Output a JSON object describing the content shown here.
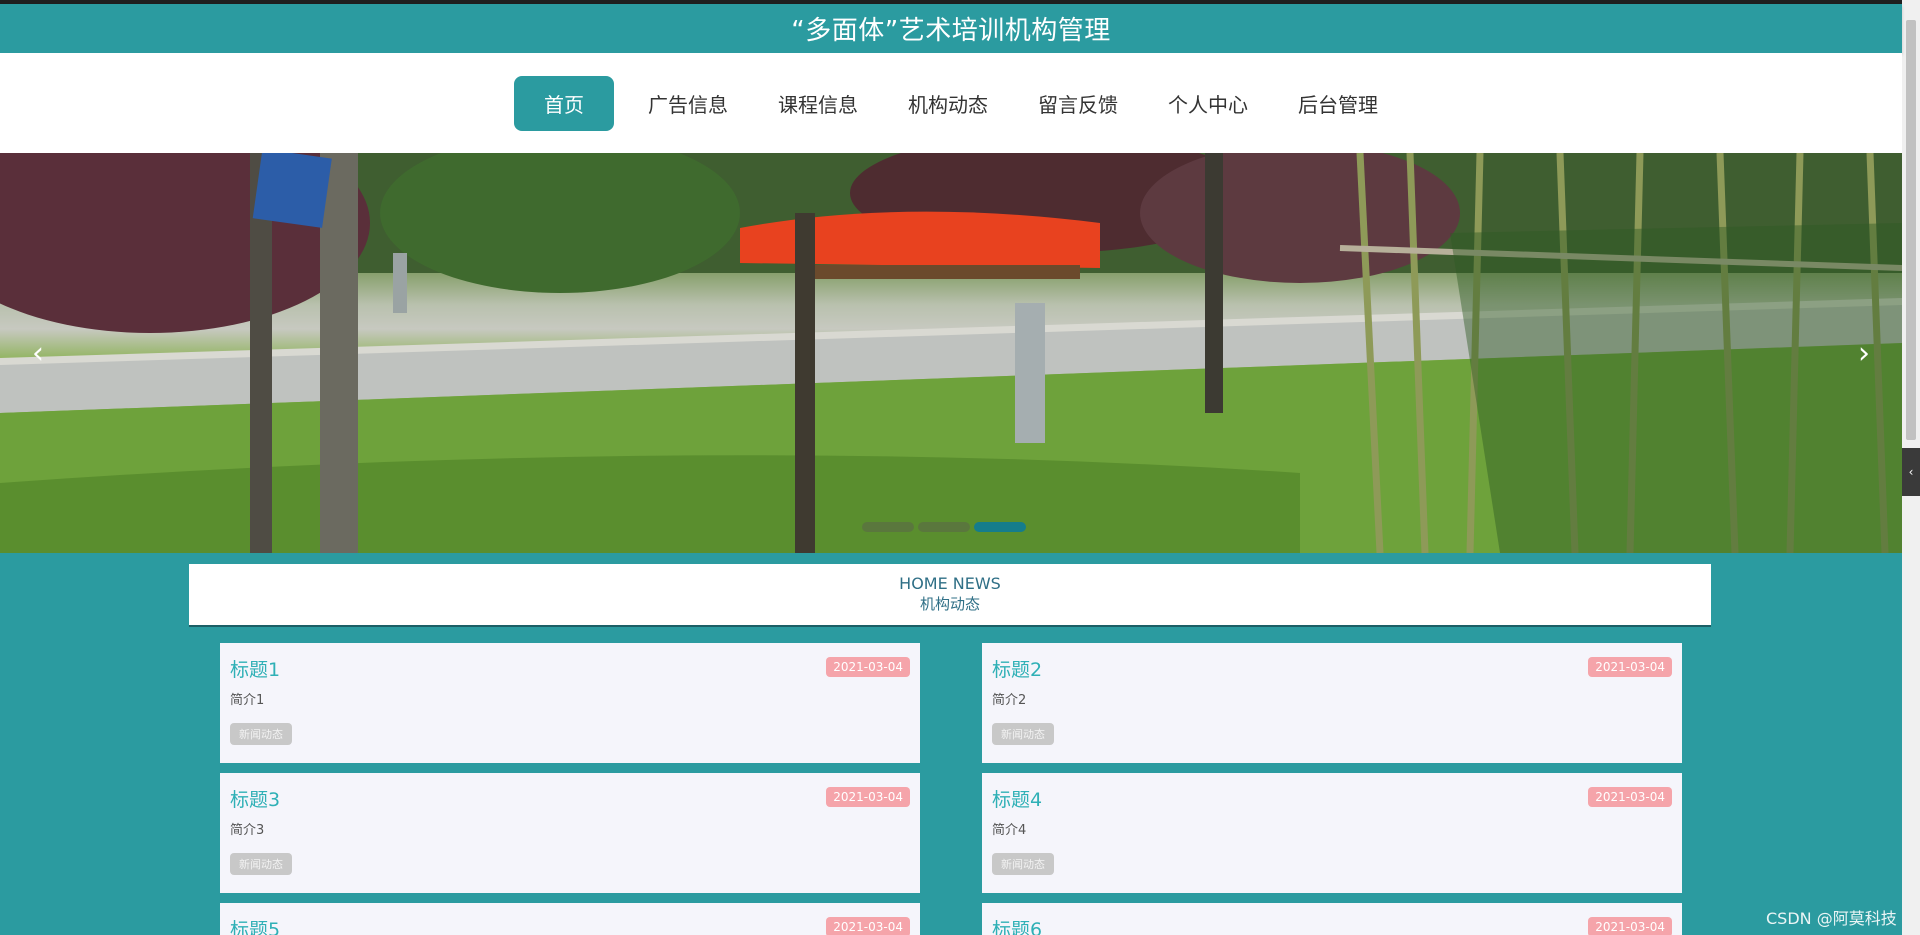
{
  "header": {
    "title": "“多面体”艺术培训机构管理"
  },
  "nav": {
    "items": [
      {
        "label": "首页",
        "active": true
      },
      {
        "label": "广告信息"
      },
      {
        "label": "课程信息"
      },
      {
        "label": "机构动态"
      },
      {
        "label": "留言反馈"
      },
      {
        "label": "个人中心"
      },
      {
        "label": "后台管理"
      }
    ]
  },
  "carousel": {
    "prev_icon": "‹",
    "next_icon": "›",
    "active_index": 2,
    "dot_count": 3
  },
  "news": {
    "heading_en": "HOME NEWS",
    "heading_zh": "机构动态",
    "cards": [
      {
        "title": "标题1",
        "date": "2021-03-04",
        "desc": "简介1",
        "tag": "新闻动态"
      },
      {
        "title": "标题2",
        "date": "2021-03-04",
        "desc": "简介2",
        "tag": "新闻动态"
      },
      {
        "title": "标题3",
        "date": "2021-03-04",
        "desc": "简介3",
        "tag": "新闻动态"
      },
      {
        "title": "标题4",
        "date": "2021-03-04",
        "desc": "简介4",
        "tag": "新闻动态"
      },
      {
        "title": "标题5",
        "date": "2021-03-04",
        "desc": "",
        "tag": ""
      },
      {
        "title": "标题6",
        "date": "2021-03-04",
        "desc": "",
        "tag": ""
      }
    ]
  },
  "watermark": "CSDN @阿莫科技",
  "colors": {
    "primary": "#2b9ba0",
    "card_title": "#2fb0b6",
    "date_badge": "#f5a4aa",
    "tag_badge": "#c8c8c8"
  }
}
